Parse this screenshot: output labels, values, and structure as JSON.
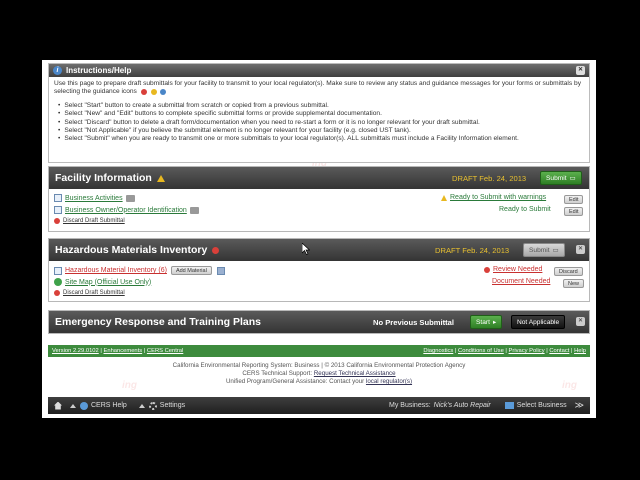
{
  "instructions": {
    "title": "Instructions/Help",
    "intro": "Use this page to prepare draft submittals for your facility to transmit to your local regulator(s). Make sure to review any status and guidance messages for your forms or submittals by selecting the guidance icons",
    "bullets": [
      "Select \"Start\" button to create a submittal from scratch or copied from a previous submittal.",
      "Select \"New\" and \"Edit\" buttons to complete specific submittal forms or provide supplemental documentation.",
      "Select \"Discard\" button to delete a draft form/documentation when you need to re-start a form or it is no longer relevant for your draft submittal.",
      "Select \"Not Applicable\" if you believe the submittal element is no longer relevant for your facility (e.g. closed UST tank).",
      "Select \"Submit\" when you are ready to transmit one or more submittals to your local regulator(s). ALL submittals must include a Facility Information element."
    ]
  },
  "facility": {
    "title": "Facility Information",
    "draft": "DRAFT Feb. 24, 2013",
    "submit_label": "Submit",
    "items": [
      {
        "label": "Business Activities",
        "status": "Ready to Submit with warnings",
        "action": "Edit"
      },
      {
        "label": "Business Owner/Operator Identification",
        "status": "Ready to Submit",
        "action": "Edit"
      }
    ],
    "discard": "Discard Draft Submittal"
  },
  "hazmat": {
    "title": "Hazardous Materials Inventory",
    "draft": "DRAFT Feb. 24, 2013",
    "submit_label": "Submit",
    "items": [
      {
        "label": "Hazardous Material Inventory (6)",
        "extra": "Add Material",
        "status": "Review Needed",
        "action": "Discard"
      },
      {
        "label": "Site Map (Official Use Only)",
        "status": "Document Needed",
        "action": "New"
      }
    ],
    "discard": "Discard Draft Submittal"
  },
  "emergency": {
    "title": "Emergency Response and Training Plans",
    "status": "No Previous Submittal",
    "start_label": "Start",
    "na_label": "Not Applicable"
  },
  "footer": {
    "left": [
      "Version 2.29.0102",
      "Enhancements",
      "CERS Central"
    ],
    "right": [
      "Diagnostics",
      "Conditions of Use",
      "Privacy Policy",
      "Contact",
      "Help"
    ],
    "line1": "California Environmental Reporting System: Business | © 2013 California Environmental Protection Agency",
    "line2_prefix": "CERS Technical Support:",
    "line2_link": "Request Technical Assistance",
    "line3_prefix": "Unified Program/General Assistance: Contact your",
    "line3_link": "local regulator(s)"
  },
  "taskbar": {
    "help": "CERS Help",
    "settings": "Settings",
    "business_prefix": "My Business:",
    "business_name": "Nick's Auto Repair",
    "select": "Select Business"
  },
  "watermark": "ing"
}
